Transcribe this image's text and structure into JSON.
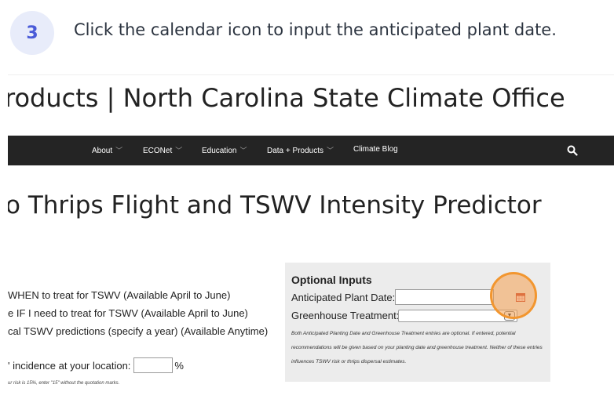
{
  "tutorial": {
    "step_number": "3",
    "instruction": "Click the calendar icon to input the anticipated plant date."
  },
  "site": {
    "title": "roducts | North Carolina State Climate Office"
  },
  "nav": {
    "items": [
      {
        "label": "About",
        "has_menu": true
      },
      {
        "label": "ECONet",
        "has_menu": true
      },
      {
        "label": "Education",
        "has_menu": true
      },
      {
        "label": "Data + Products",
        "has_menu": true
      },
      {
        "label": "Climate Blog",
        "has_menu": false
      }
    ],
    "search_icon": "search-icon"
  },
  "page": {
    "heading": "o Thrips Flight and TSWV Intensity Predictor",
    "options": [
      "WHEN to treat for TSWV (Available April to June)",
      "e IF I need to treat for TSWV (Available April to June)",
      "cal TSWV predictions (specify a year) (Available Anytime)"
    ],
    "incidence_label": "' incidence at your location:",
    "incidence_value": "",
    "incidence_unit": "%",
    "incidence_note": "ur risk is 15%, enter \"15\" without the quotation marks."
  },
  "optional_inputs": {
    "title": "Optional Inputs",
    "plant_date_label": "Anticipated Plant Date:",
    "plant_date_value": "",
    "calendar_icon": "calendar-icon",
    "greenhouse_label": "Greenhouse Treatment:",
    "greenhouse_value": "",
    "note": "Both Anticipated Planting Date and Greenhouse Treatment entries are optional. If entered, potential recommendations will be given based on your planting date and greenhouse treatment. Neither of these entries influences TSWV risk or thrips dispersal estimates."
  },
  "colors": {
    "step_badge_bg": "#e8ecfa",
    "step_badge_text": "#4a5bd8",
    "navbar_bg": "#242424",
    "highlight": "#f2962f",
    "optional_box_bg": "#ececec"
  }
}
